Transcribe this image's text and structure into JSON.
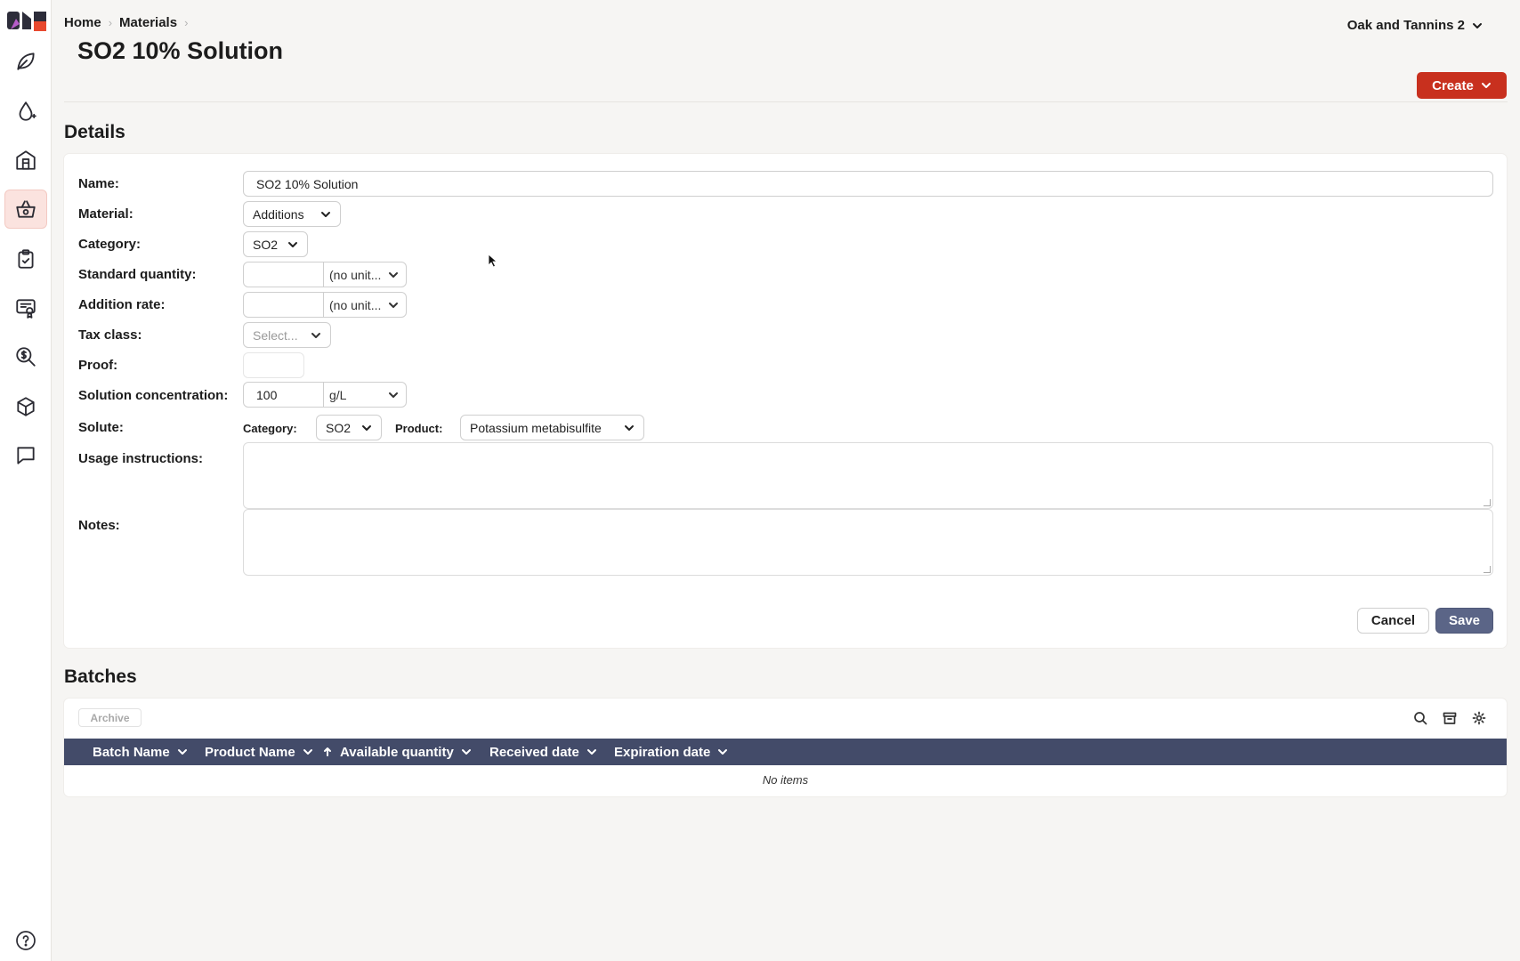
{
  "header": {
    "breadcrumb": [
      "Home",
      "Materials"
    ],
    "title": "SO2 10% Solution",
    "org": "Oak and Tannins 2",
    "create_label": "Create"
  },
  "sidebar": {
    "items": [
      {
        "icon": "leaf-icon"
      },
      {
        "icon": "drop-icon"
      },
      {
        "icon": "winery-icon"
      },
      {
        "icon": "basket-icon",
        "active": true
      },
      {
        "icon": "clipboard-check-icon"
      },
      {
        "icon": "certificate-icon"
      },
      {
        "icon": "dollar-search-icon"
      },
      {
        "icon": "box-icon"
      },
      {
        "icon": "chat-icon"
      }
    ],
    "help_icon": "help-icon"
  },
  "details": {
    "section_title": "Details",
    "name_label": "Name:",
    "name_value": "SO2 10% Solution",
    "material_label": "Material:",
    "material_value": "Additions",
    "category_label": "Category:",
    "category_value": "SO2",
    "standard_quantity_label": "Standard quantity:",
    "standard_quantity_value": "",
    "standard_quantity_unit": "(no unit...",
    "addition_rate_label": "Addition rate:",
    "addition_rate_value": "",
    "addition_rate_unit": "(no unit...",
    "tax_class_label": "Tax class:",
    "tax_class_placeholder": "Select...",
    "proof_label": "Proof:",
    "proof_value": "",
    "solution_concentration_label": "Solution concentration:",
    "solution_concentration_value": "100",
    "solution_concentration_unit": "g/L",
    "solute_label": "Solute:",
    "solute_category_label": "Category:",
    "solute_category_value": "SO2",
    "solute_product_label": "Product:",
    "solute_product_value": "Potassium metabisulfite",
    "usage_label": "Usage instructions:",
    "notes_label": "Notes:",
    "cancel_label": "Cancel",
    "save_label": "Save"
  },
  "batches": {
    "section_title": "Batches",
    "archive_label": "Archive",
    "columns": [
      "Batch Name",
      "Product Name",
      "Available quantity",
      "Received date",
      "Expiration date"
    ],
    "empty_text": "No items"
  }
}
